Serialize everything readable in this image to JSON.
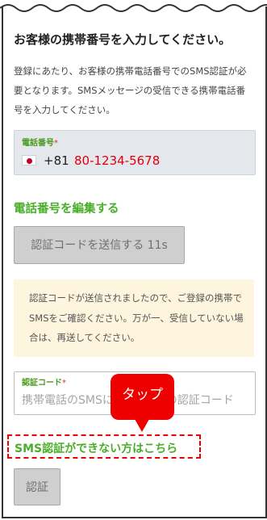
{
  "page": {
    "title": "お客様の携帯番号を入力してください。",
    "description": "登録にあたり、お客様の携帯電話番号でのSMS認証が必要となります。SMSメッセージの受信できる携帯電話番号を入力してください。"
  },
  "phone": {
    "label": "電話番号",
    "required_mark": "*",
    "country_flag": "japan-flag-icon",
    "country_code": "+81",
    "number": "80-1234-5678",
    "number_color": "#e0000c"
  },
  "edit_link": "電話番号を編集する",
  "send_button": {
    "label": "認証コードを送信する 11s",
    "enabled": false
  },
  "notice": "認証コードが送信されましたので、ご登録の携帯でSMSをご確認ください。万が一、受信していない場合は、再送してください。",
  "sms_code": {
    "label": "認証コード",
    "required_mark": "*",
    "placeholder": "携帯電話のSMSに届いた6桁の認証コード"
  },
  "tap_callout": "タップ",
  "cant_sms_link": "SMS認証ができない方はこちら",
  "auth_button": {
    "label": "認証",
    "enabled": false
  },
  "colors": {
    "accent_green": "#4aae2a",
    "callout_red": "#ee0000",
    "notice_bg": "#fdf5dd",
    "input_bg": "#e4e7eb"
  }
}
